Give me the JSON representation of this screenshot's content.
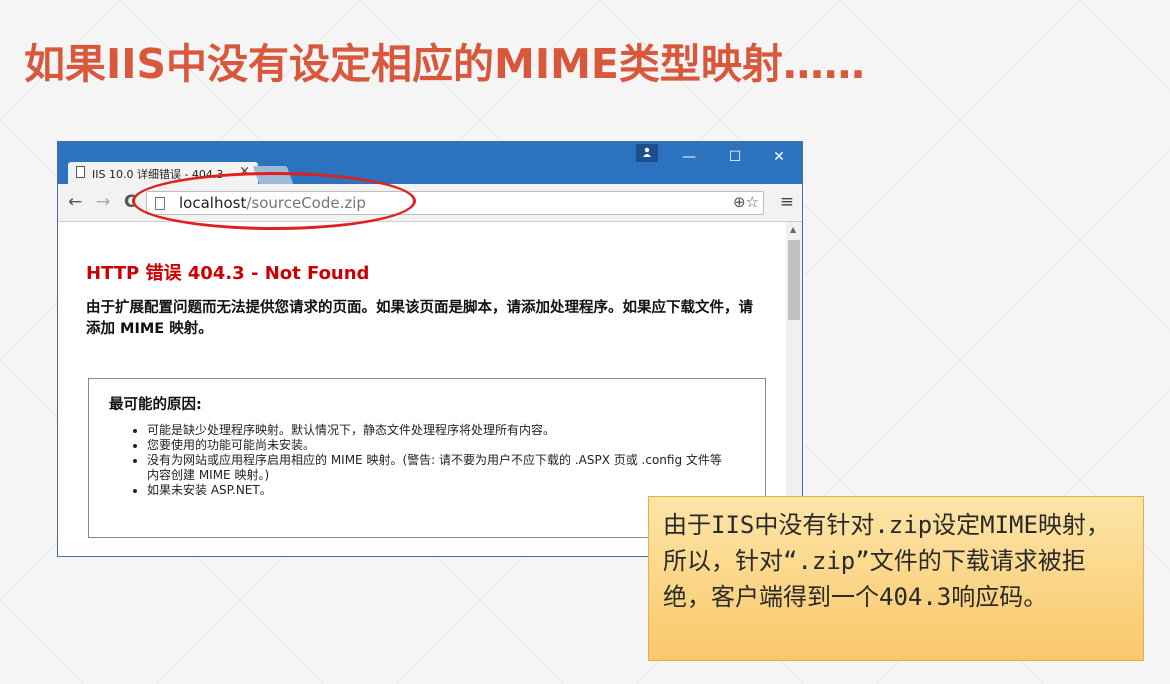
{
  "slide": {
    "title": "如果IIS中没有设定相应的MIME类型映射……"
  },
  "browser": {
    "tab_title": "IIS 10.0 详细错误 - 404.3",
    "tab_close": "×",
    "profile_icon": "person-icon",
    "window_controls": {
      "minimize": "—",
      "maximize": "☐",
      "close": "✕"
    },
    "nav": {
      "back": "←",
      "forward": "→",
      "reload": "C"
    },
    "url_host": "localhost",
    "url_path": "/sourceCode.zip",
    "zoom_icon": "⊕",
    "star_icon": "☆",
    "menu_icon": "≡"
  },
  "page": {
    "error_title": "HTTP 错误 404.3 - Not Found",
    "error_desc": "由于扩展配置问题而无法提供您请求的页面。如果该页面是脚本，请添加处理程序。如果应下载文件，请添加 MIME 映射。",
    "reasons_title": "最可能的原因:",
    "reasons": [
      "可能是缺少处理程序映射。默认情况下，静态文件处理程序将处理所有内容。",
      "您要使用的功能可能尚未安装。",
      "没有为网站或应用程序启用相应的 MIME 映射。(警告: 请不要为用户不应下载的 .ASPX 页或 .config 文件等内容创建 MIME 映射。)",
      "如果未安装 ASP.NET。"
    ]
  },
  "note": {
    "text": "由于IIS中没有针对.zip设定MIME映射，所以，针对“.zip”文件的下载请求被拒绝，客户端得到一个404.3响应码。"
  },
  "colors": {
    "title": "#d9573b",
    "browser_frame": "#2b72bf",
    "error_red": "#cc0000",
    "highlight_ellipse": "#e0201c",
    "note_bg": "#f9c86a"
  }
}
